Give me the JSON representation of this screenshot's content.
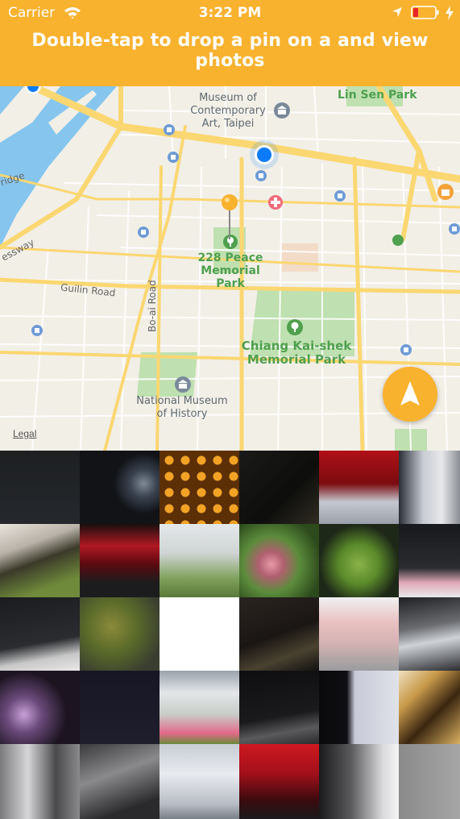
{
  "status_bar": {
    "carrier": "Carrier",
    "time": "3:22 PM"
  },
  "header": {
    "instruction": "Double-tap to drop a pin on a and view photos",
    "accent_color": "#F9B22E"
  },
  "map": {
    "labels": {
      "museum": "Museum of\nContemporary\nArt, Taipei",
      "lin_sen_park": "Lin Sen Park",
      "peace_park": "228 Peace\nMemorial Park",
      "chiang": "Chiang Kai-shek\nMemorial Park",
      "national_museum": "National Museum\nof History",
      "guilin_road": "Guilin Road",
      "boai_road": "Bo-ai Road",
      "ridge": "ridge",
      "essway": "essway"
    },
    "legal": "Legal",
    "icons": [
      "museum-icon",
      "hospital-icon",
      "tree-icon",
      "metro-icon",
      "user-location-dot",
      "dropped-pin",
      "compass-icon"
    ]
  },
  "photos": {
    "rows": 5,
    "columns": 6,
    "count": 30
  }
}
